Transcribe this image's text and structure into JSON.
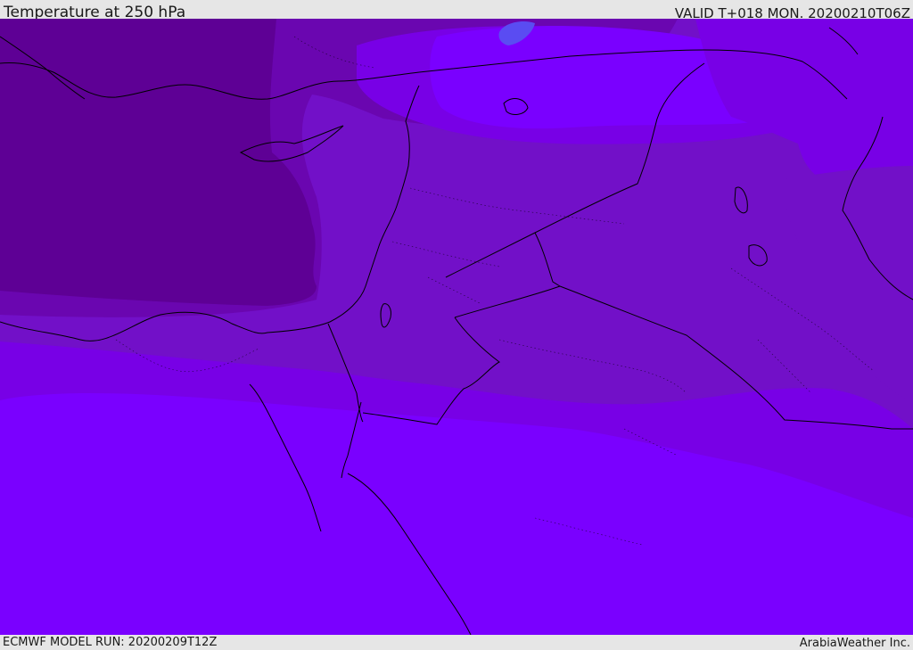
{
  "header": {
    "title": "Temperature at 250 hPa",
    "valid_time": "VALID T+018 MON. 20200210T06Z"
  },
  "footer": {
    "model_run": "ECMWF MODEL RUN: 20200209T12Z",
    "credit": "ArabiaWeather Inc."
  },
  "colors": {
    "band_warmest": "#7a00ff",
    "band_warm": "#7800e6",
    "band_mid": "#7210c8",
    "band_cool": "#6a06b0",
    "band_coldest": "#5e0095",
    "blue_patch": "#5a4cf2",
    "coastline": "#000000"
  }
}
